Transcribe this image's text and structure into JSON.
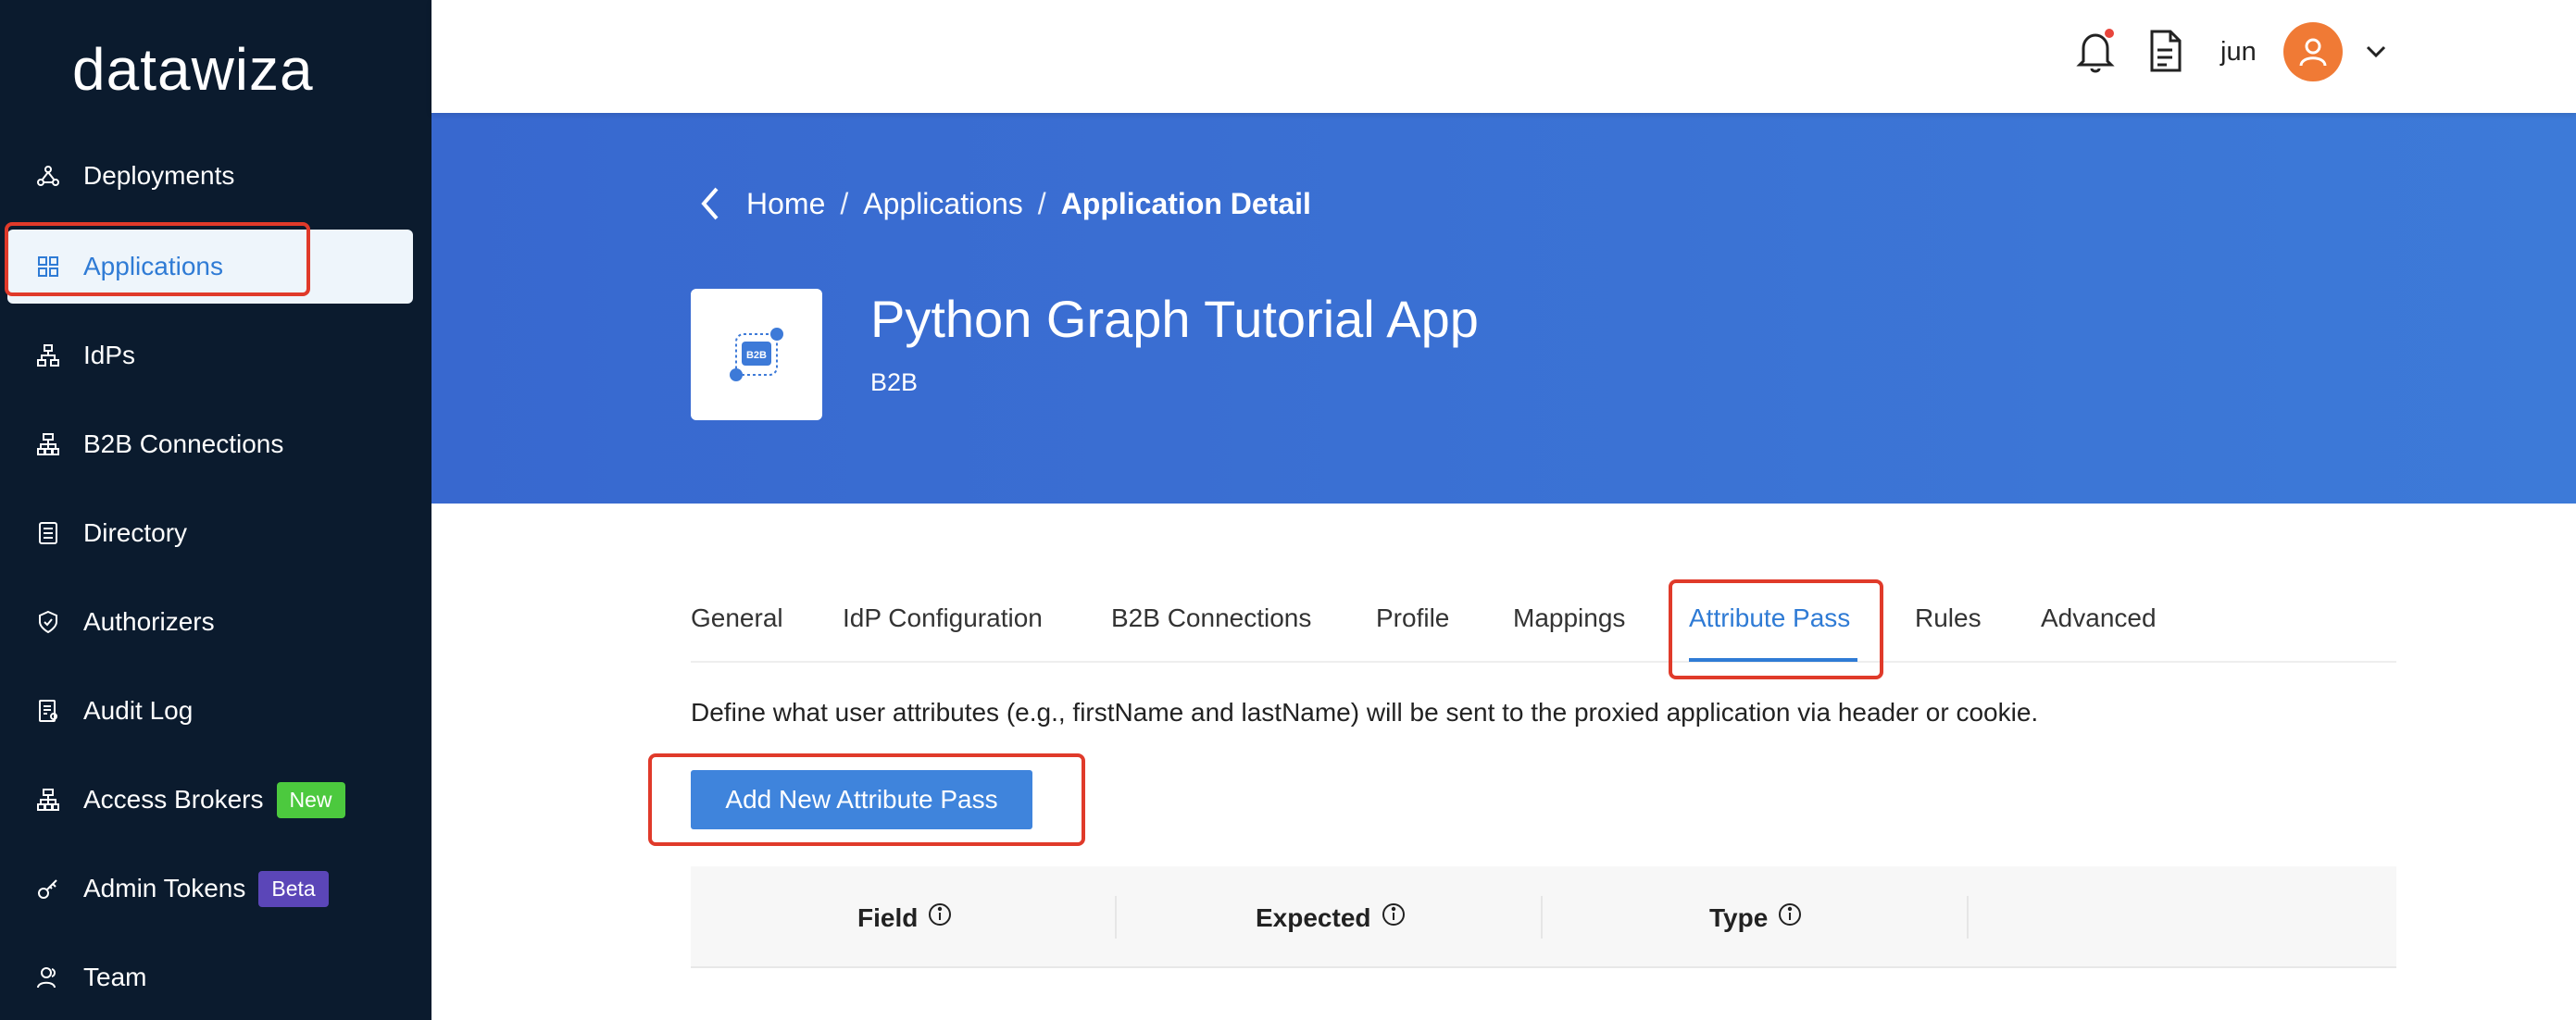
{
  "sidebar": {
    "logo": "datawiza",
    "items": [
      {
        "label": "Deployments",
        "icon": "deployments-icon"
      },
      {
        "label": "Applications",
        "icon": "grid-icon",
        "active": true
      },
      {
        "label": "IdPs",
        "icon": "network-icon"
      },
      {
        "label": "B2B Connections",
        "icon": "hierarchy-icon"
      },
      {
        "label": "Directory",
        "icon": "directory-icon"
      },
      {
        "label": "Authorizers",
        "icon": "shield-icon"
      },
      {
        "label": "Audit Log",
        "icon": "audit-log-icon"
      },
      {
        "label": "Access Brokers",
        "icon": "hierarchy-icon",
        "badge": "New"
      },
      {
        "label": "Admin Tokens",
        "icon": "token-icon",
        "badge": "Beta"
      },
      {
        "label": "Team",
        "icon": "team-icon"
      }
    ]
  },
  "header": {
    "user_name": "jun",
    "notification_dot_color": "#e8453c"
  },
  "breadcrumb": {
    "home": "Home",
    "sep1": "/",
    "applications": "Applications",
    "sep2": "/",
    "current": "Application Detail"
  },
  "app": {
    "title": "Python Graph Tutorial App",
    "type": "B2B",
    "icon_label": "B2B"
  },
  "tabs": [
    {
      "label": "General"
    },
    {
      "label": "IdP Configuration"
    },
    {
      "label": "B2B Connections"
    },
    {
      "label": "Profile"
    },
    {
      "label": "Mappings"
    },
    {
      "label": "Attribute Pass",
      "active": true
    },
    {
      "label": "Rules"
    },
    {
      "label": "Advanced"
    }
  ],
  "attribute_pass": {
    "description": "Define what user attributes (e.g., firstName and lastName) will be sent to the proxied application via header or cookie.",
    "add_button": "Add New Attribute Pass",
    "columns": [
      "Field",
      "Expected",
      "Type"
    ]
  },
  "colors": {
    "sidebar_bg": "#0b1b2e",
    "accent": "#2f7bd5",
    "hero": "#3b72d4",
    "annotation": "#e03a2a",
    "badge_new": "#4cc93e",
    "badge_beta": "#5b46b8"
  }
}
